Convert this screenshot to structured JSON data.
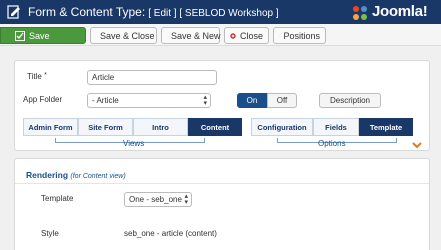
{
  "header": {
    "title": "Form & Content Type:",
    "subtitle": "[ Edit ] [ SEBLOD Workshop ]",
    "brand": "Joomla!",
    "colors": {
      "bar": "#1a3867"
    }
  },
  "toolbar": {
    "save": "Save",
    "save_close": "Save & Close",
    "save_new": "Save & New",
    "close": "Close",
    "positions": "Positions"
  },
  "form": {
    "title_label": "Title",
    "title_required": "*",
    "title_value": "Article",
    "app_folder_label": "App Folder",
    "app_folder_value": "- Article",
    "toggle_on": "On",
    "toggle_off": "Off",
    "description": "Description"
  },
  "tabs": {
    "left": [
      "Admin Form",
      "Site Form",
      "Intro",
      "Content"
    ],
    "left_active": "Content",
    "left_caption": "Views",
    "right": [
      "Configuration",
      "Fields",
      "Template"
    ],
    "right_active": "Template",
    "right_caption": "Options"
  },
  "rendering": {
    "title": "Rendering",
    "hint": "(for Content view)",
    "template_label": "Template",
    "template_value": "One - seb_one",
    "style_label": "Style",
    "style_value": "seb_one - article (content)"
  }
}
